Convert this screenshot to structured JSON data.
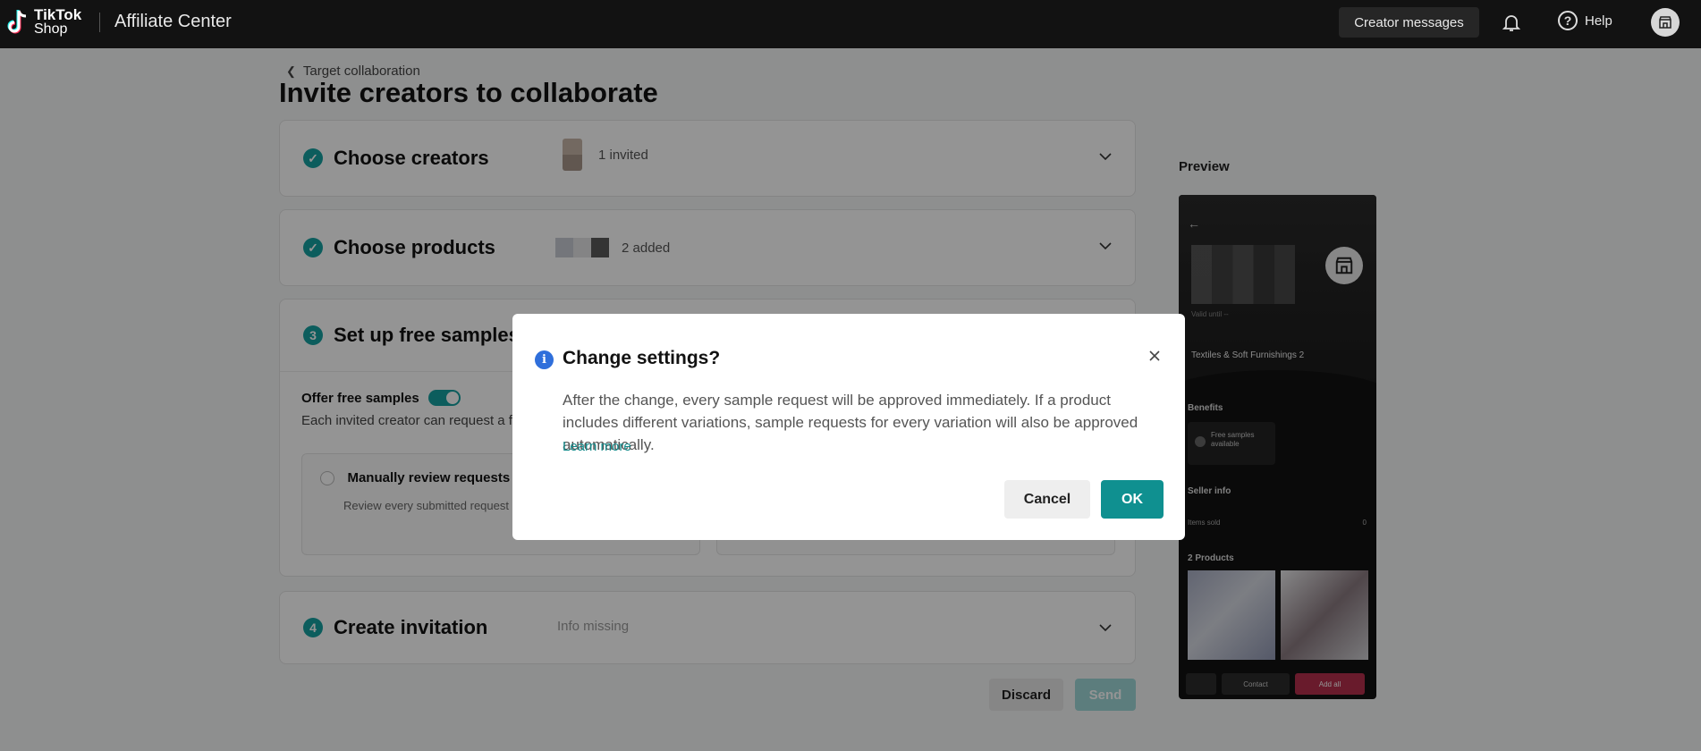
{
  "topbar": {
    "logo_line1": "TikTok",
    "logo_line2": "Shop",
    "app_title": "Affiliate Center",
    "creator_messages_label": "Creator messages",
    "help_label": "Help"
  },
  "page": {
    "back_link": "Target collaboration",
    "title": "Invite creators to collaborate"
  },
  "steps": {
    "creators": {
      "title": "Choose creators",
      "meta": "1 invited"
    },
    "products": {
      "title": "Choose products",
      "meta": "2 added"
    },
    "samples": {
      "number": "3",
      "title": "Set up free samples",
      "toggle_label": "Offer free samples",
      "toggle_on": true,
      "description": "Each invited creator can request a fre",
      "option_manual_title": "Manually review requests",
      "option_manual_desc": "Review every submitted request be"
    },
    "invitation": {
      "number": "4",
      "title": "Create invitation",
      "meta": "Info missing"
    }
  },
  "actions": {
    "discard_label": "Discard",
    "send_label": "Send"
  },
  "preview": {
    "label": "Preview",
    "valid_until": "Valid until --",
    "category": "Textiles & Soft Furnishings 2",
    "benefits_title": "Benefits",
    "benefit_text": "Free samples available",
    "seller_info_title": "Seller info",
    "items_sold_label": "Items sold",
    "items_sold_value": "0",
    "products_title": "2 Products",
    "contact_label": "Contact",
    "add_all_label": "Add all"
  },
  "modal": {
    "title": "Change settings?",
    "body": "After the change, every sample request will be approved immediately. If a product includes different variations, sample requests for every variation will also be approved automatically.",
    "learn_more": "Learn more",
    "cancel_label": "Cancel",
    "ok_label": "OK"
  },
  "colors": {
    "accent": "#0f9090",
    "topbar": "#121212",
    "info": "#2f6fdb",
    "add_all": "#b6304d"
  }
}
